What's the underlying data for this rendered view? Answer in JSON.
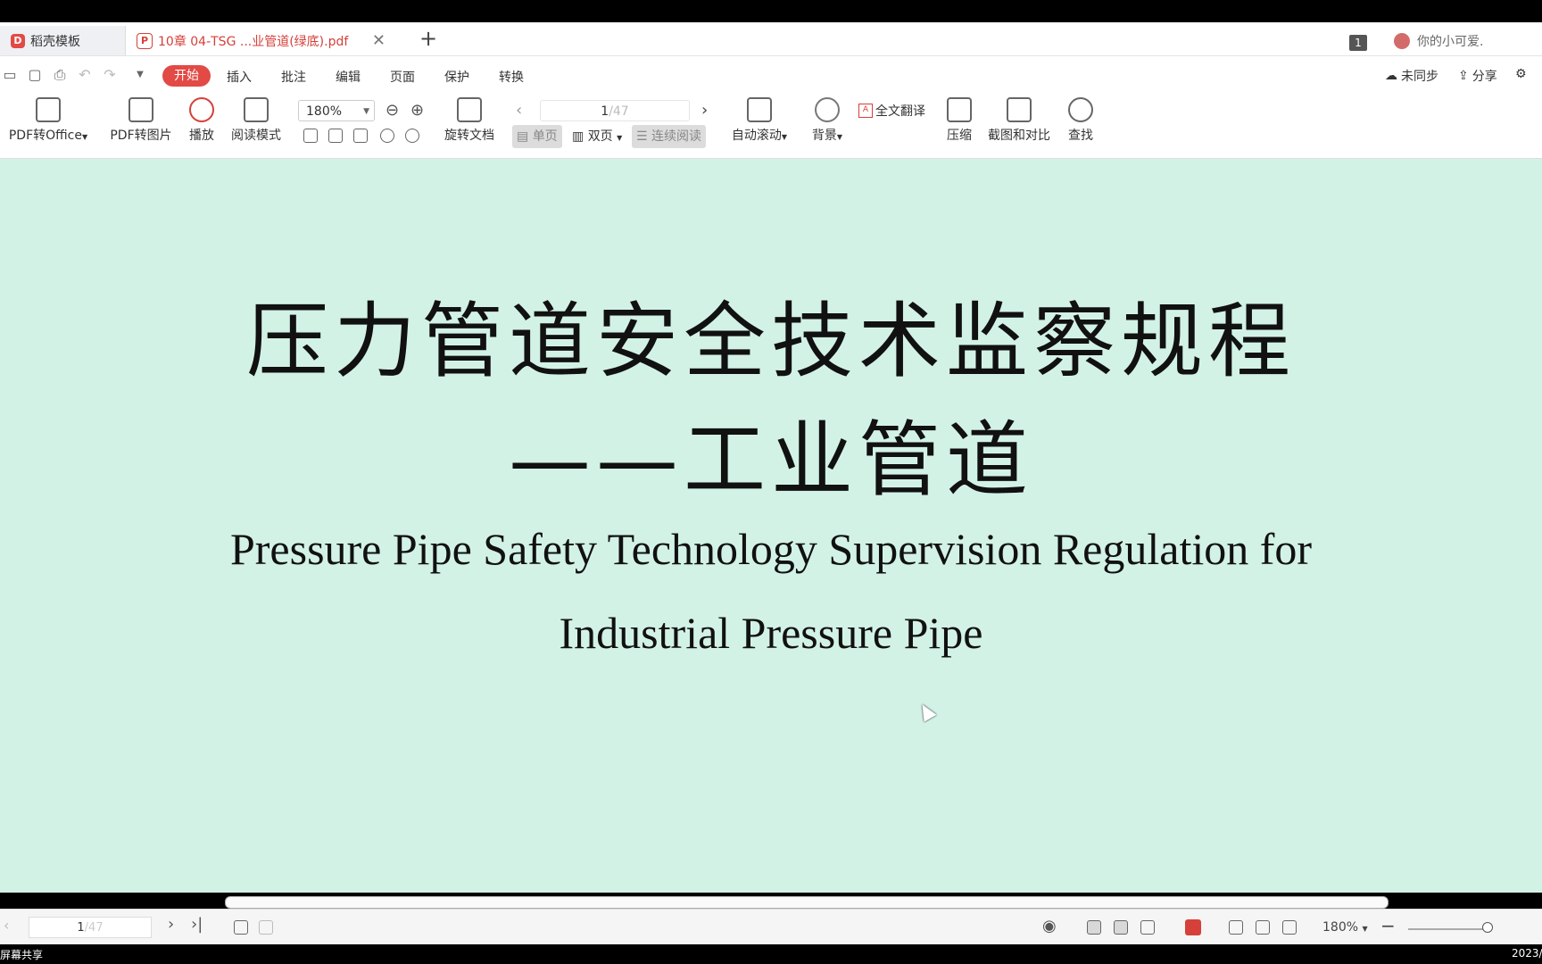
{
  "tabs": [
    {
      "label": "稻壳模板"
    },
    {
      "label": "10章 04-TSG ...业管道(绿底).pdf"
    }
  ],
  "header": {
    "page_badge": "1",
    "username": "你的小可爱."
  },
  "menu": {
    "items": [
      "开始",
      "插入",
      "批注",
      "编辑",
      "页面",
      "保护",
      "转换"
    ],
    "sync": "未同步",
    "share": "分享"
  },
  "ribbon": {
    "pdf_to_office": "PDF转Office",
    "pdf_to_image": "PDF转图片",
    "play": "播放",
    "read_mode": "阅读模式",
    "zoom": "180%",
    "rotate": "旋转文档",
    "page_current": "1",
    "page_total": "/47",
    "single": "单页",
    "double": "双页",
    "continuous": "连续阅读",
    "auto_scroll": "自动滚动",
    "background": "背景",
    "translate": "全文翻译",
    "compress": "压缩",
    "screenshot_compare": "截图和对比",
    "find": "查找"
  },
  "document": {
    "title_zh": "压力管道安全技术监察规程",
    "subtitle_zh": "——工业管道",
    "title_en_line1": "Pressure Pipe Safety Technology Supervision Regulation for",
    "title_en_line2": "Industrial Pressure Pipe"
  },
  "status": {
    "page_current": "1",
    "page_total": "/47",
    "zoom": "180%"
  },
  "taskbar": {
    "left": "屏幕共享",
    "right": "2023/"
  },
  "colors": {
    "accent": "#e24a46",
    "doc_bg": "#d3f2e6"
  }
}
